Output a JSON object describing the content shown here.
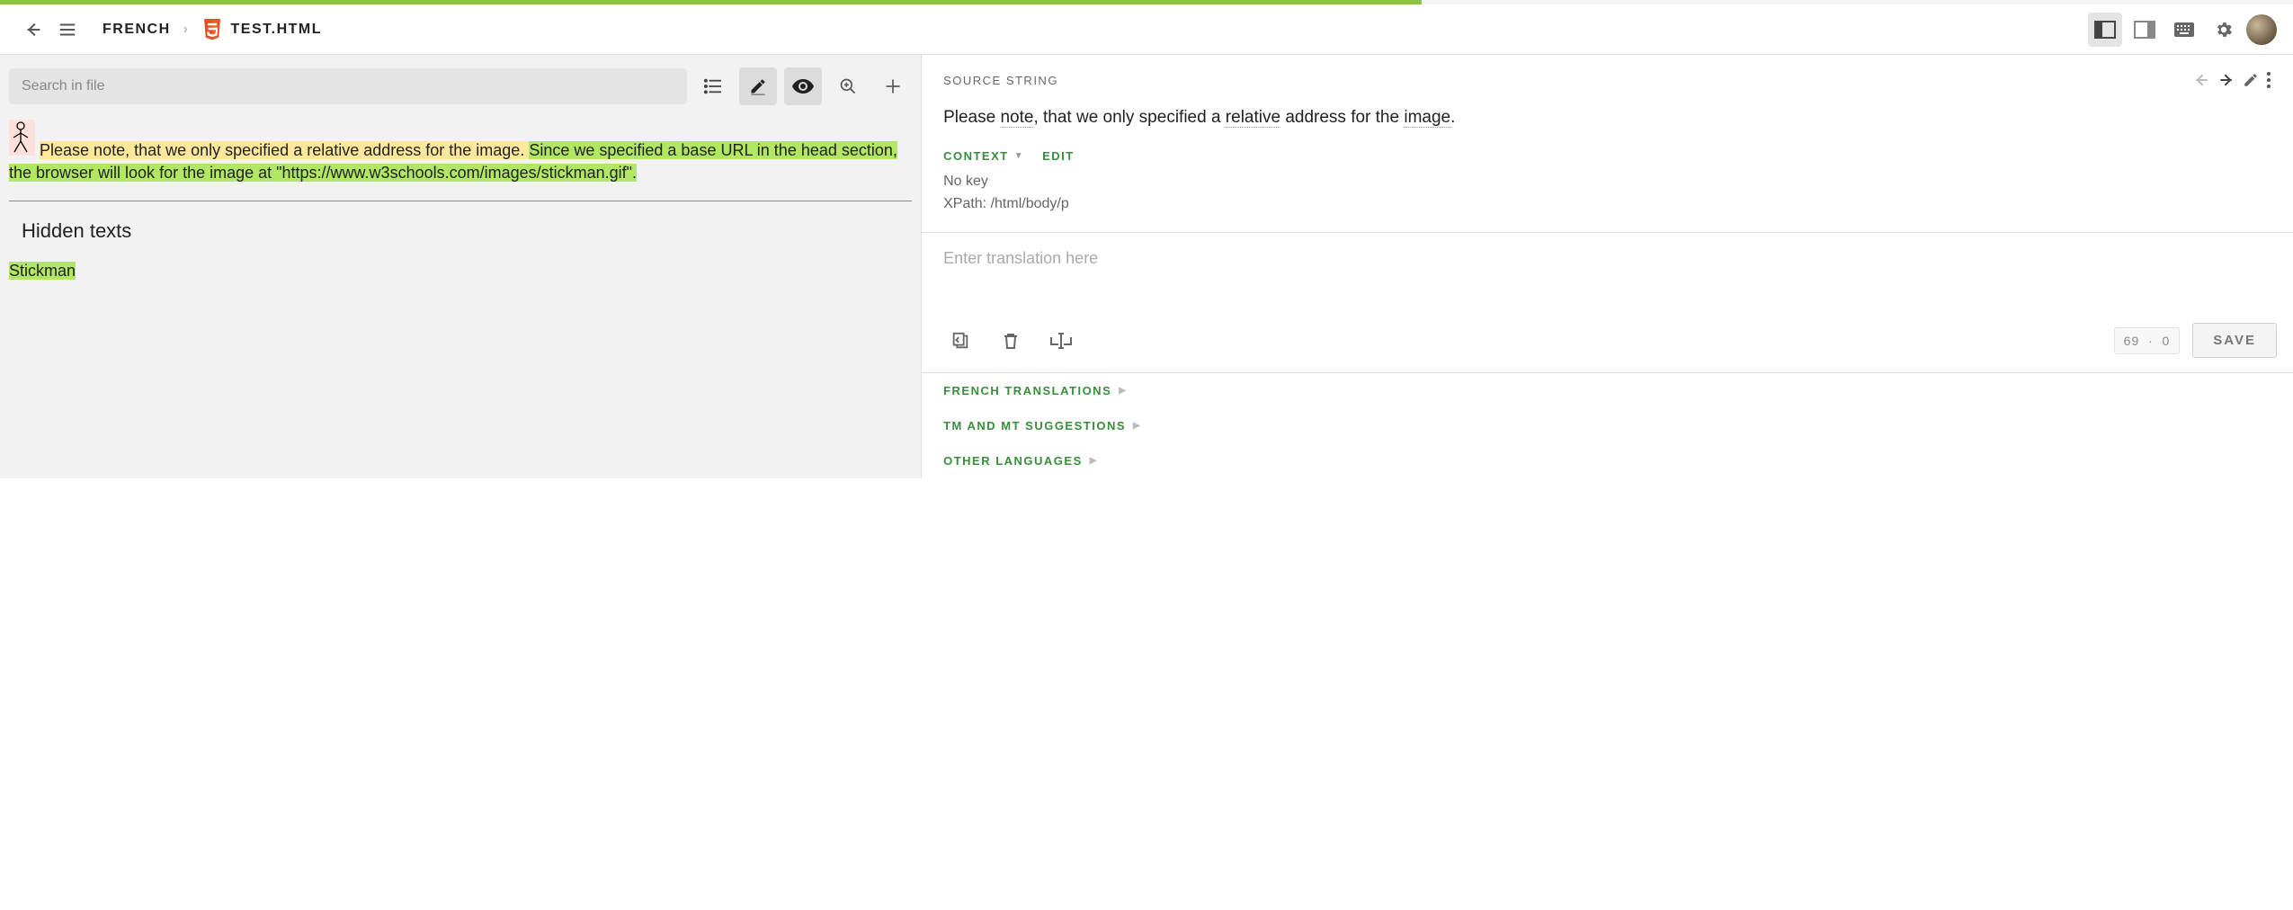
{
  "progress_pct": 62,
  "breadcrumb": {
    "language": "FRENCH",
    "file": "TEST.HTML"
  },
  "left": {
    "search_placeholder": "Search in file",
    "preview": {
      "sentence1": "Please note, that we only specified a relative address for the image. ",
      "sentence2": "Since we specified a base URL in the head section, the browser will look for the image at \"https://www.w3schools.com/images/stickman.gif\"."
    },
    "hidden_heading": "Hidden texts",
    "hidden_item": "Stickman"
  },
  "right": {
    "section_label": "SOURCE STRING",
    "source_parts": {
      "p1": "Please ",
      "p2": "note",
      "p3": ", that we only specified a ",
      "p4": "relative",
      "p5": " address for the ",
      "p6": "image",
      "p7": "."
    },
    "context_label": "CONTEXT",
    "edit_label": "EDIT",
    "no_key": "No key",
    "xpath": "XPath: /html/body/p",
    "translation_placeholder": "Enter translation here",
    "counter_left": "69",
    "counter_right": "0",
    "save_label": "SAVE",
    "sections": {
      "french": "FRENCH TRANSLATIONS",
      "tm": "TM AND MT SUGGESTIONS",
      "other": "OTHER LANGUAGES"
    }
  }
}
